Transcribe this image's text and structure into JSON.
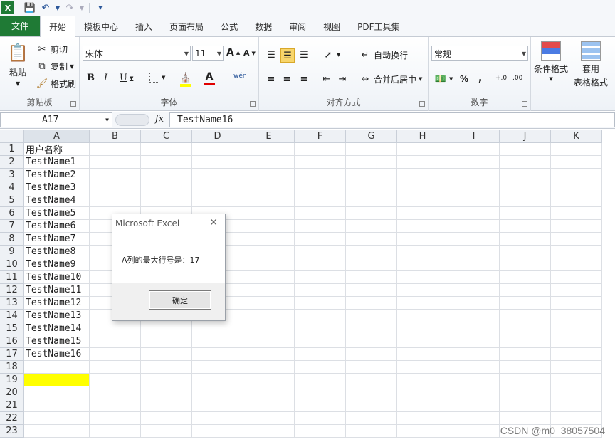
{
  "qat": {
    "app_icon": "excel-icon",
    "save_icon": "save-icon",
    "undo_icon": "undo-icon",
    "redo_icon": "redo-icon",
    "customize_icon": "customize-qat-icon"
  },
  "tabs": [
    {
      "label": "文件"
    },
    {
      "label": "开始"
    },
    {
      "label": "模板中心"
    },
    {
      "label": "插入"
    },
    {
      "label": "页面布局"
    },
    {
      "label": "公式"
    },
    {
      "label": "数据"
    },
    {
      "label": "审阅"
    },
    {
      "label": "视图"
    },
    {
      "label": "PDF工具集"
    }
  ],
  "ribbon": {
    "clipboard": {
      "paste": "粘贴",
      "cut": "剪切",
      "copy": "复制",
      "format_painter": "格式刷",
      "group": "剪贴板"
    },
    "font": {
      "name": "宋体",
      "size": "11",
      "grow": "A",
      "shrink": "A",
      "bold": "B",
      "italic": "I",
      "underline": "U",
      "font_color": "A",
      "phonetic": "wén",
      "group": "字体"
    },
    "alignment": {
      "wrap": "自动换行",
      "merge": "合并后居中",
      "group": "对齐方式"
    },
    "number": {
      "format": "常规",
      "percent": "%",
      "comma": ",",
      "increase": "+.0",
      "decrease": ".00",
      "group": "数字"
    },
    "styles": {
      "conditional": "条件格式",
      "table_line1": "套用",
      "table_line2": "表格格式"
    }
  },
  "formula_bar": {
    "name_box": "A17",
    "fx": "fx",
    "value": "TestName16"
  },
  "grid": {
    "columns": [
      "A",
      "B",
      "C",
      "D",
      "E",
      "F",
      "G",
      "H",
      "I",
      "J",
      "K"
    ],
    "rows": [
      "1",
      "2",
      "3",
      "4",
      "5",
      "6",
      "7",
      "8",
      "9",
      "10",
      "11",
      "12",
      "13",
      "14",
      "15",
      "16",
      "17",
      "18",
      "19",
      "20",
      "21",
      "22",
      "23"
    ],
    "colA": [
      "用户名称",
      "TestName1",
      "TestName2",
      "TestName3",
      "TestName4",
      "TestName5",
      "TestName6",
      "TestName7",
      "TestName8",
      "TestName9",
      "TestName10",
      "TestName11",
      "TestName12",
      "TestName13",
      "TestName14",
      "TestName15",
      "TestName16",
      "",
      "",
      "",
      "",
      "",
      ""
    ],
    "highlight_color": "#ffff00"
  },
  "dialog": {
    "title": "Microsoft Excel",
    "message": "A列的最大行号是：17",
    "ok": "确定"
  },
  "watermark": "CSDN @m0_38057504",
  "colors": {
    "file_tab": "#1f7a35",
    "accent": "#2b579a"
  }
}
